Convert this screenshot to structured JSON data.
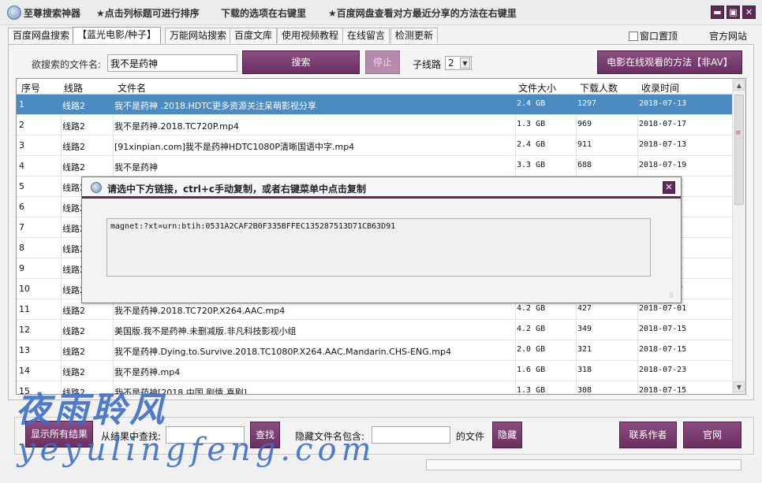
{
  "titlebar": {
    "app_name": "至尊搜索神器",
    "hint_sort": "★点击列标题可进行排序",
    "hint_right_click": "下载的选项在右键里",
    "hint_baidu": "★百度网盘查看对方最近分享的方法在右键里",
    "minimize": "▬",
    "maximize": "▣",
    "close": "✕"
  },
  "tabs": [
    {
      "label": "百度网盘搜索"
    },
    {
      "label": "【蓝光电影/种子】"
    },
    {
      "label": "万能网站搜索"
    },
    {
      "label": "百度文库"
    },
    {
      "label": "使用视频教程"
    },
    {
      "label": "在线留言"
    },
    {
      "label": "检测更新"
    }
  ],
  "topright": {
    "stay_on_top_label": "窗口置顶",
    "official_site_label": "官方网站"
  },
  "search": {
    "label": "欲搜索的文件名:",
    "value": "我不是药神",
    "search_button": "搜索",
    "stop_button": "停止",
    "subline_label": "子线路",
    "subline_value": "2",
    "dropdown_arrow": "▼",
    "online_watch_button": "电影在线观看的方法【非AV】"
  },
  "table": {
    "columns": [
      "序号",
      "线路",
      "文件名",
      "文件大小",
      "下载人数",
      "收录时间"
    ],
    "rows": [
      [
        "1",
        "线路2",
        "我不是药神 .2018.HDTC更多资源关注呆萌影视分享",
        "2.4 GB",
        "1297",
        "2018-07-13"
      ],
      [
        "2",
        "线路2",
        "我不是药神.2018.TC720P.mp4",
        "1.3 GB",
        "969",
        "2018-07-17"
      ],
      [
        "3",
        "线路2",
        "[91xinpian.com]我不是药神HDTC1080P清晰国语中字.mp4",
        "2.4 GB",
        "911",
        "2018-07-13"
      ],
      [
        "4",
        "线路2",
        "我不是药神",
        "3.3 GB",
        "688",
        "2018-07-19"
      ],
      [
        "5",
        "线路2",
        "",
        "",
        "",
        "15"
      ],
      [
        "6",
        "线路2",
        "",
        "",
        "",
        "13"
      ],
      [
        "7",
        "线路2",
        "",
        "",
        "",
        "13"
      ],
      [
        "8",
        "线路2",
        "",
        "",
        "",
        "15"
      ],
      [
        "9",
        "线路2",
        "",
        "",
        "",
        "15"
      ],
      [
        "10",
        "线路2",
        "",
        "",
        "",
        "19"
      ],
      [
        "11",
        "线路2",
        "我不是药神.2018.TC720P.X264.AAC.mp4",
        "4.2 GB",
        "427",
        "2018-07-01"
      ],
      [
        "12",
        "线路2",
        "美国版.我不是药神.未删减版.非凡科技影视小组",
        "4.2 GB",
        "349",
        "2018-07-15"
      ],
      [
        "13",
        "线路2",
        "我不是药神.Dying.to.Survive.2018.TC1080P.X264.AAC.Mandarin.CHS-ENG.mp4",
        "2.0 GB",
        "321",
        "2018-07-15"
      ],
      [
        "14",
        "线路2",
        "我不是药神.mp4",
        "1.6 GB",
        "318",
        "2018-07-23"
      ],
      [
        "15",
        "线路2",
        "我不是药神[2018 中国 剧情 喜剧]",
        "1.3 GB",
        "308",
        "2018-07-15"
      ]
    ],
    "scroll_up": "▲",
    "scroll_down": "▼",
    "scroll_grip": "≡"
  },
  "dialog": {
    "title": "请选中下方链接，ctrl+c手动复制，或者右键菜单中点击复制",
    "close": "✕",
    "link": "magnet:?xt=urn:btih:0531A2CAF2B0F335BFFEC135287513D71CB63D91",
    "grip": "⠿"
  },
  "bottom": {
    "show_all_button": "显示所有结果",
    "find_in_results_label": "从结果中查找:",
    "find_value": "",
    "find_button": "查找",
    "hide_label": "隐藏文件名包含:",
    "hide_value": "",
    "hide_suffix": "的文件",
    "hide_button": "隐藏",
    "contact_button": "联系作者",
    "official_button": "官网"
  },
  "watermark": {
    "cn": "夜雨聆风",
    "en": "yeyulingfeng.com"
  },
  "colors": {
    "accent": "#6b2f62",
    "selected_row": "#4c8ac4",
    "watermark": "#3c6ec8"
  }
}
